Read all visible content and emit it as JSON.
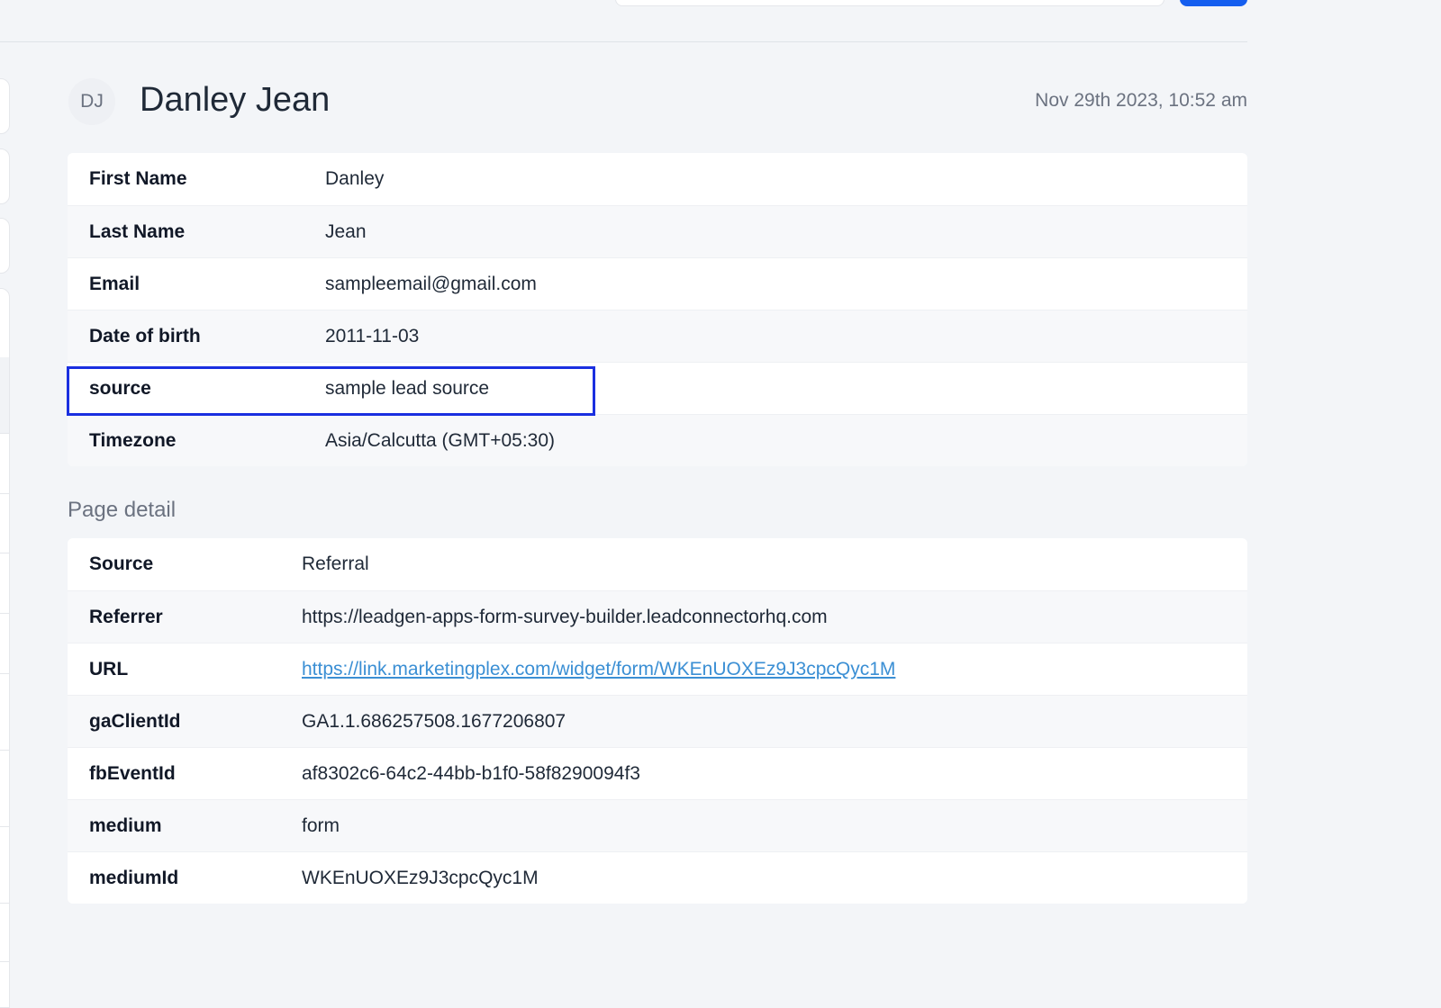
{
  "header": {
    "avatar_initials": "DJ",
    "name": "Danley Jean",
    "timestamp": "Nov 29th 2023, 10:52 am"
  },
  "contact_fields": [
    {
      "label": "First Name",
      "value": "Danley"
    },
    {
      "label": "Last Name",
      "value": "Jean"
    },
    {
      "label": "Email",
      "value": "sampleemail@gmail.com"
    },
    {
      "label": "Date of birth",
      "value": "2011-11-03"
    },
    {
      "label": "source",
      "value": "sample lead source"
    },
    {
      "label": "Timezone",
      "value": "Asia/Calcutta (GMT+05:30)"
    }
  ],
  "page_detail": {
    "title": "Page detail",
    "fields": [
      {
        "label": "Source",
        "value": "Referral"
      },
      {
        "label": "Referrer",
        "value": "https://leadgen-apps-form-survey-builder.leadconnectorhq.com"
      },
      {
        "label": "URL",
        "value": "https://link.marketingplex.com/widget/form/WKEnUOXEz9J3cpcQyc1M"
      },
      {
        "label": "gaClientId",
        "value": "GA1.1.686257508.1677206807"
      },
      {
        "label": "fbEventId",
        "value": "af8302c6-64c2-44bb-b1f0-58f8290094f3"
      },
      {
        "label": "medium",
        "value": "form"
      },
      {
        "label": "mediumId",
        "value": "WKEnUOXEz9J3cpcQyc1M"
      }
    ]
  },
  "colors": {
    "link": "#3b8fd4",
    "highlight_border": "#1a2fe0",
    "primary_button": "#155eef"
  }
}
